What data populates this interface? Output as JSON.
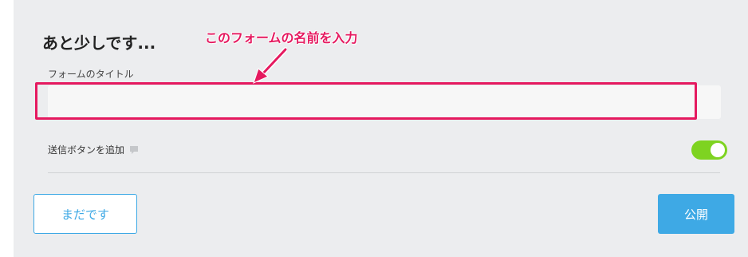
{
  "dialog": {
    "heading": "あと少しです...",
    "form_title_label": "フォームのタイトル",
    "form_title_value": "",
    "submit_toggle_label": "送信ボタンを追加",
    "submit_toggle_on": true,
    "later_button": "まだです",
    "publish_button": "公開"
  },
  "annotation": {
    "text": "このフォームの名前を入力",
    "color": "#e5195f"
  },
  "colors": {
    "accent": "#3ea9e5",
    "toggle_on": "#7ed321",
    "annotation": "#e5195f"
  },
  "icons": {
    "comment": "comment-icon",
    "arrow": "arrow-icon"
  }
}
